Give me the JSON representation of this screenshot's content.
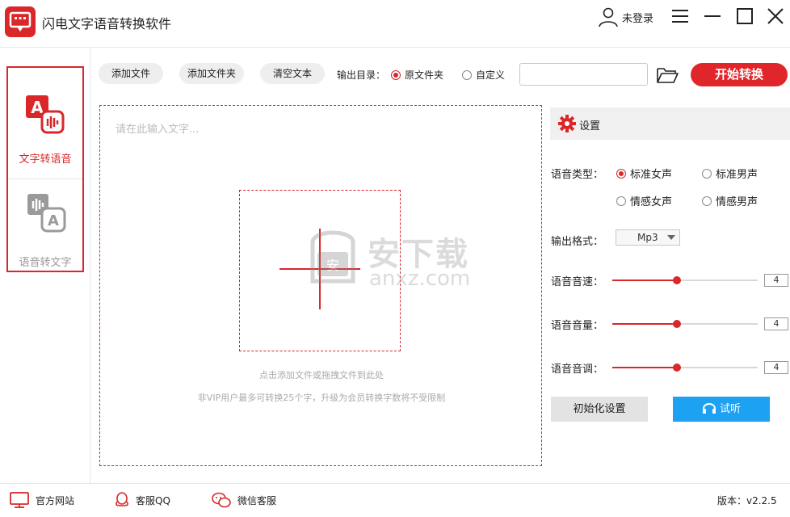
{
  "app": {
    "title": "闪电文字语音转换软件"
  },
  "user": {
    "label": "未登录"
  },
  "sidebar": {
    "modes": [
      {
        "label": "文字转语音",
        "active": true
      },
      {
        "label": "语音转文字",
        "active": false
      }
    ]
  },
  "toolbar": {
    "add_file": "添加文件",
    "add_folder": "添加文件夹",
    "clear_text": "清空文本",
    "output_dir_label": "输出目录：",
    "output_options": [
      "原文件夹",
      "自定义"
    ],
    "output_selected": "原文件夹",
    "path_value": "",
    "start": "开始转换"
  },
  "editor": {
    "placeholder": "请在此输入文字...",
    "hint_drop": "点击添加文件或拖拽文件到此处",
    "hint_vip": "非VIP用户最多可转换25个字，升级为会员转换字数将不受限制"
  },
  "settings": {
    "title": "设置",
    "voice_type_label": "语音类型：",
    "voice_options": [
      "标准女声",
      "标准男声",
      "情感女声",
      "情感男声"
    ],
    "voice_selected": "标准女声",
    "format_label": "输出格式：",
    "format_value": "Mp3",
    "speed_label": "语音音速：",
    "speed_value": "4",
    "volume_label": "语音音量：",
    "volume_value": "4",
    "pitch_label": "语音音调：",
    "pitch_value": "4",
    "slider_max": 9,
    "reset": "初始化设置",
    "listen": "试听"
  },
  "footer": {
    "website": "官方网站",
    "qq": "客服QQ",
    "wechat": "微信客服",
    "version": "版本：v2.2.5"
  },
  "colors": {
    "accent": "#d9272a",
    "listen": "#1da1f2"
  },
  "watermark": {
    "brand": "安下载",
    "domain": "anxz.com"
  }
}
